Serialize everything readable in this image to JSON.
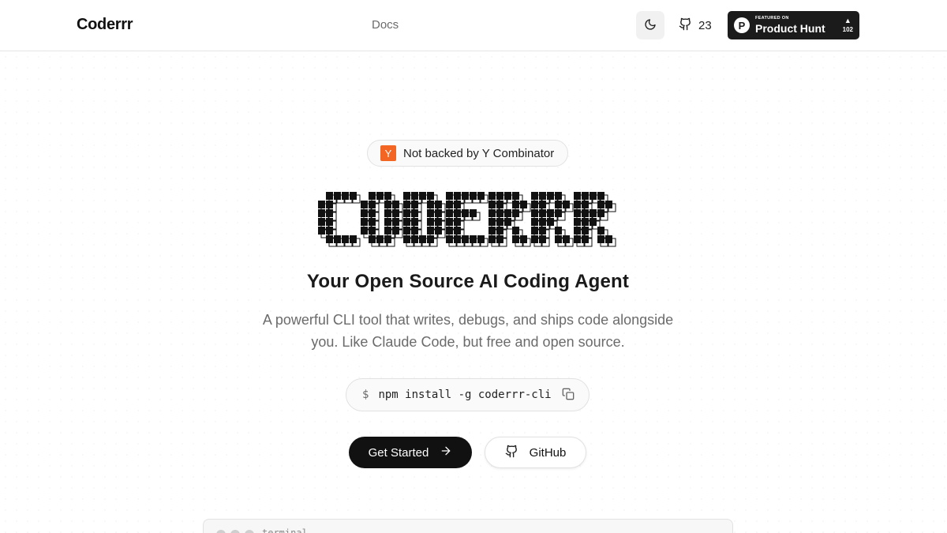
{
  "header": {
    "brand": "Coderrr",
    "nav": {
      "docs_label": "Docs"
    },
    "theme_toggle_icon": "moon-icon",
    "github": {
      "icon": "github-icon",
      "stars": "23"
    },
    "product_hunt": {
      "kicker": "FEATURED ON",
      "name": "Product Hunt",
      "logo_letter": "P",
      "vote_icon": "▲",
      "votes": "102"
    }
  },
  "hero": {
    "badge": {
      "logo_letter": "Y",
      "text": "Not backed by Y Combinator",
      "logo_color": "#f26522"
    },
    "ascii_logo_text": "CODERRR",
    "tagline": "Your Open Source AI Coding Agent",
    "subtitle": "A powerful CLI tool that writes, debugs, and ships code alongside you. Like Claude Code, but free and open source.",
    "install": {
      "prompt": "$",
      "command": "npm install -g coderrr-cli",
      "copy_icon": "copy-icon"
    },
    "buttons": {
      "primary": {
        "label": "Get Started",
        "icon": "arrow-right-icon"
      },
      "secondary": {
        "label": "GitHub",
        "icon": "github-icon"
      }
    }
  },
  "terminal": {
    "title": "terminal"
  },
  "colors": {
    "primary": "#111111",
    "muted_text": "#6b6b6b",
    "border": "#e2e2e2",
    "yc_orange": "#f26522"
  }
}
